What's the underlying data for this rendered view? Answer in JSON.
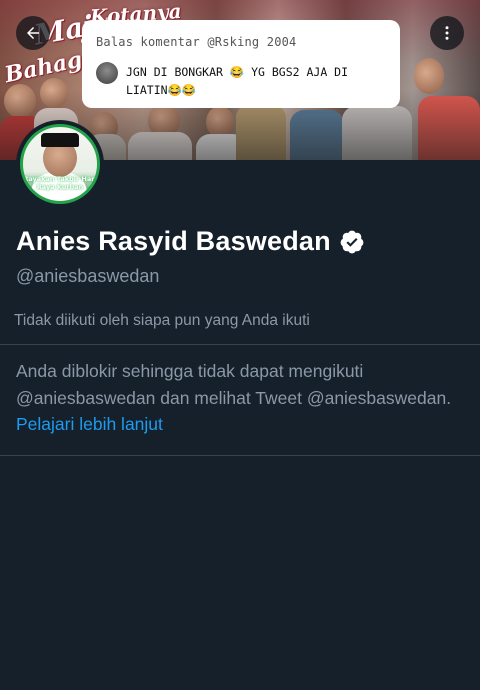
{
  "banner": {
    "text_1": "Maju",
    "text_2": "Kotanya",
    "text_3": "Bahagia"
  },
  "reply_card": {
    "title": "Balas komentar @Rsking 2004",
    "comment": "JGN DI BONGKAR 😂 YG BGS2 AJA DI LIATIN😂😂"
  },
  "profile": {
    "avatar_caption": "Rayakan Takbir Hari Raya Kurban",
    "display_name": "Anies Rasyid Baswedan",
    "handle": "@aniesbaswedan",
    "followed_by": "Tidak diikuti oleh siapa pun yang Anda ikuti",
    "blocked_message": "Anda diblokir sehingga tidak dapat mengikuti @aniesbaswedan dan melihat Tweet @aniesbaswedan.",
    "learn_more": "Pelajari lebih lanjut"
  },
  "colors": {
    "background": "#15202b",
    "secondary_text": "#8b98a5",
    "link": "#1d9bf0",
    "divider": "#38444d"
  }
}
